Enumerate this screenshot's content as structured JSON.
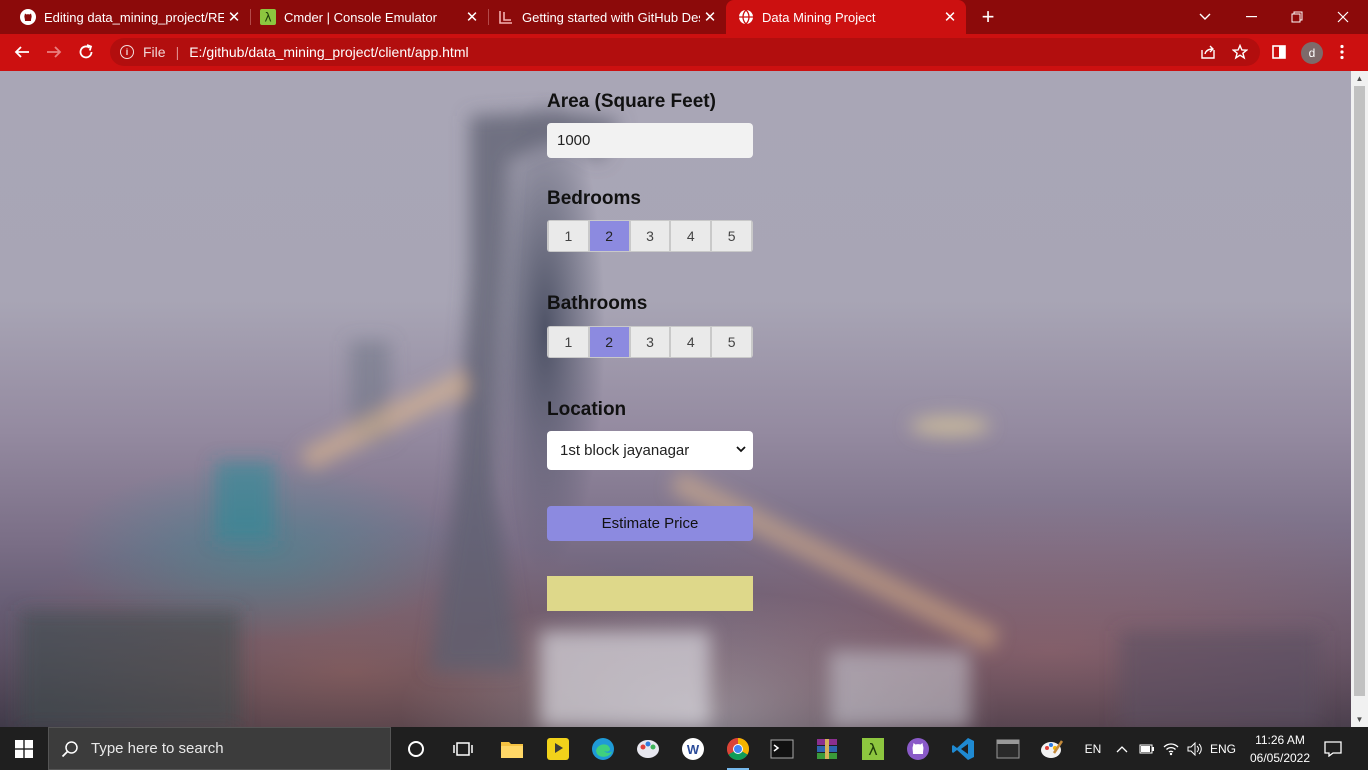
{
  "browser": {
    "tabs": [
      {
        "title": "Editing data_mining_project/README.md",
        "icon": "github-icon",
        "active": false
      },
      {
        "title": "Cmder | Console Emulator",
        "icon": "cmder-icon",
        "active": false
      },
      {
        "title": "Getting started with GitHub Desktop",
        "icon": "github-desktop-icon",
        "active": false
      },
      {
        "title": "Data Mining Project",
        "icon": "globe-icon",
        "active": true
      }
    ],
    "address": {
      "scheme_label": "File",
      "separator": "|",
      "url": "E:/github/data_mining_project/client/app.html"
    },
    "profile_initial": "d",
    "accent_color": "#cc1010"
  },
  "form": {
    "area": {
      "label": "Area (Square Feet)",
      "value": "1000"
    },
    "bedrooms": {
      "label": "Bedrooms",
      "options": [
        "1",
        "2",
        "3",
        "4",
        "5"
      ],
      "selected": "2"
    },
    "bathrooms": {
      "label": "Bathrooms",
      "options": [
        "1",
        "2",
        "3",
        "4",
        "5"
      ],
      "selected": "2"
    },
    "location": {
      "label": "Location",
      "selected": "1st block jayanagar"
    },
    "estimate_button": "Estimate Price",
    "result": ""
  },
  "taskbar": {
    "search_placeholder": "Type here to search",
    "apps": [
      "cortana-icon",
      "task-view-icon",
      "file-explorer-icon",
      "player-icon",
      "edge-icon",
      "paint-icon",
      "writer-icon",
      "chrome-icon",
      "terminal-icon",
      "winrar-icon",
      "cmder-icon",
      "github-desktop-icon",
      "vscode-icon",
      "console-icon",
      "paint3d-icon"
    ],
    "keyboard": "EN",
    "language": "ENG",
    "time": "11:26 AM",
    "date": "06/05/2022"
  }
}
